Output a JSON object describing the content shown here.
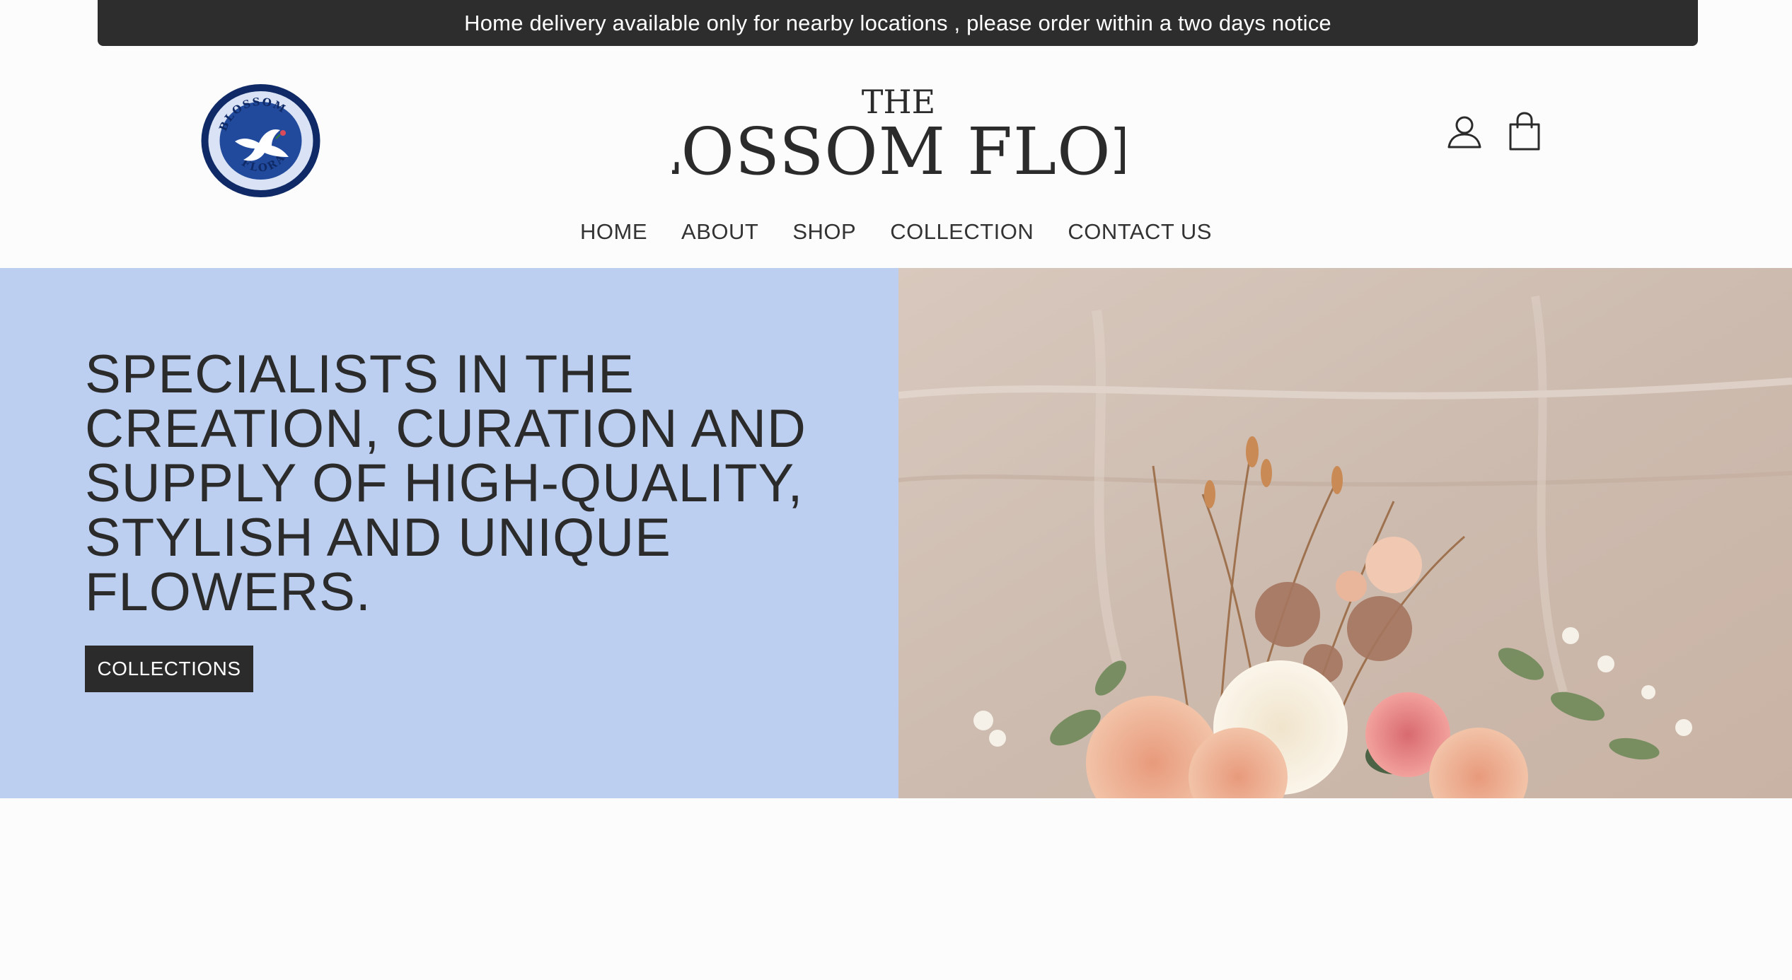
{
  "announcement": {
    "text": "Home delivery available only for nearby locations , please order within a two days notice"
  },
  "brand": {
    "badge_text_top": "BLOSSOM",
    "badge_text_bottom": "FLORA",
    "wordmark_small": "THE",
    "wordmark_large": "BLOSSOM FLORA"
  },
  "header_icons": [
    "account-icon",
    "shopping-bag-icon"
  ],
  "nav": {
    "items": [
      {
        "label": "HOME"
      },
      {
        "label": "ABOUT"
      },
      {
        "label": "SHOP"
      },
      {
        "label": "COLLECTION"
      },
      {
        "label": "CONTACT US"
      }
    ]
  },
  "hero": {
    "heading_lines": [
      "SPECIALISTS IN THE",
      "CREATION, CURATION AND",
      "SUPPLY OF HIGH-QUALITY,",
      "STYLISH AND UNIQUE",
      "FLOWERS."
    ],
    "button_label": "COLLECTIONS"
  },
  "colors": {
    "announcement_bg": "#2d2d2d",
    "hero_panel_bg": "#bccff0",
    "badge_navy": "#0f2a66",
    "button_bg": "#2b2b2b"
  }
}
